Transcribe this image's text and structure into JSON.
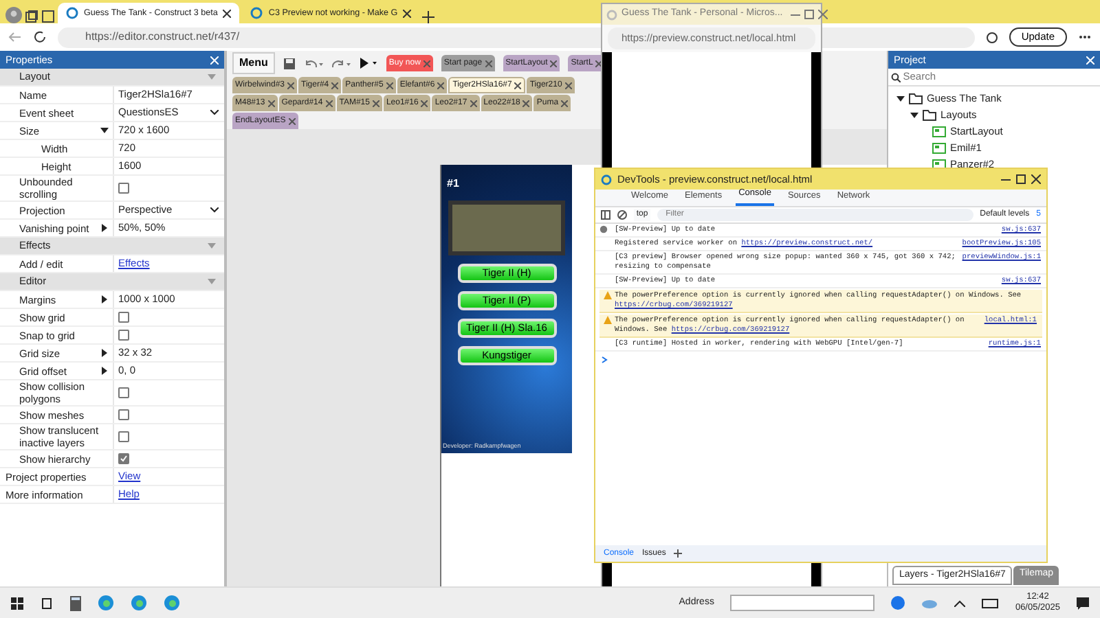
{
  "browser": {
    "tabs": [
      {
        "title": "Guess The Tank - Construct 3 beta",
        "selected": true
      },
      {
        "title": "C3 Preview not working - Make G",
        "selected": false
      }
    ],
    "url": "https://editor.construct.net/r437/",
    "update_button": "Update"
  },
  "properties": {
    "title": "Properties",
    "rows": [
      {
        "kind": "section",
        "label": "Layout"
      },
      {
        "kind": "text",
        "label": "Name",
        "value": "Tiger2HSla16#7"
      },
      {
        "kind": "select",
        "label": "Event sheet",
        "value": "QuestionsES"
      },
      {
        "kind": "text",
        "label": "Size",
        "value": "720 x 1600",
        "expanded": true,
        "children": [
          {
            "kind": "text",
            "label": "Width",
            "value": "720"
          },
          {
            "kind": "text",
            "label": "Height",
            "value": "1600"
          }
        ]
      },
      {
        "kind": "checkbox",
        "label": "Unbounded scrolling",
        "checked": false
      },
      {
        "kind": "select",
        "label": "Projection",
        "value": "Perspective"
      },
      {
        "kind": "text",
        "label": "Vanishing point",
        "value": "50%, 50%",
        "expanded": false
      },
      {
        "kind": "section",
        "label": "Effects"
      },
      {
        "kind": "link",
        "label": "Add / edit",
        "value": "Effects"
      },
      {
        "kind": "section",
        "label": "Editor"
      },
      {
        "kind": "text",
        "label": "Margins",
        "value": "1000 x 1000",
        "expanded": false
      },
      {
        "kind": "checkbox",
        "label": "Show grid",
        "checked": false
      },
      {
        "kind": "checkbox",
        "label": "Snap to grid",
        "checked": false
      },
      {
        "kind": "text",
        "label": "Grid size",
        "value": "32 x 32",
        "expanded": false
      },
      {
        "kind": "text",
        "label": "Grid offset",
        "value": "0, 0",
        "expanded": false
      },
      {
        "kind": "checkbox",
        "label": "Show collision polygons",
        "checked": false
      },
      {
        "kind": "checkbox",
        "label": "Show meshes",
        "checked": false
      },
      {
        "kind": "checkbox",
        "label": "Show translucent inactive layers",
        "checked": false
      },
      {
        "kind": "checkbox",
        "label": "Show hierarchy",
        "checked": true
      },
      {
        "kind": "footer-link",
        "label": "Project properties",
        "value": "View"
      },
      {
        "kind": "footer-link",
        "label": "More information",
        "value": "Help"
      }
    ]
  },
  "editor": {
    "menu_button": "Menu",
    "tab_rows": [
      [
        {
          "label": "Buy now",
          "color": "#f25656",
          "selected": false
        },
        {
          "label": "Start page",
          "color": "#9c9c9c",
          "selected": false
        },
        {
          "label": "StartLayout",
          "color": "#b9a4c4",
          "selected": false
        },
        {
          "label": "StartL",
          "color": "#b9a4c4",
          "selected": false
        }
      ],
      [
        {
          "label": "Wirbelwind#3",
          "color": "#bcb193",
          "selected": false
        },
        {
          "label": "Tiger#4",
          "color": "#bcb193",
          "selected": false
        },
        {
          "label": "Panther#5",
          "color": "#bcb193",
          "selected": false
        },
        {
          "label": "Elefant#6",
          "color": "#bcb193",
          "selected": false
        },
        {
          "label": "Tiger2HSla16#7",
          "color": "#bcb193",
          "selected": true
        },
        {
          "label": "Tiger210",
          "color": "#bcb193",
          "selected": false
        }
      ],
      [
        {
          "label": "M48#13",
          "color": "#bcb193",
          "selected": false
        },
        {
          "label": "Gepard#14",
          "color": "#bcb193",
          "selected": false
        },
        {
          "label": "TAM#15",
          "color": "#bcb193",
          "selected": false
        },
        {
          "label": "Leo1#16",
          "color": "#bcb193",
          "selected": false
        },
        {
          "label": "Leo2#17",
          "color": "#bcb193",
          "selected": false
        },
        {
          "label": "Leo22#18",
          "color": "#bcb193",
          "selected": false
        },
        {
          "label": "Puma",
          "color": "#bcb193",
          "selected": false
        }
      ],
      [
        {
          "label": "EndLayoutES",
          "color": "#b9a4c4",
          "selected": false
        }
      ]
    ],
    "game": {
      "number": "#1",
      "answers": [
        "Tiger II (H)",
        "Tiger II (P)",
        "Tiger II (H) Sla.16",
        "Kungstiger"
      ],
      "credit": "Developer: Radkampfwagen"
    }
  },
  "project": {
    "title": "Project",
    "search_placeholder": "Search",
    "tree": [
      {
        "label": "Guess The Tank",
        "expanded": true,
        "kind": "folder",
        "children": [
          {
            "label": "Layouts",
            "expanded": true,
            "kind": "folder",
            "children": [
              {
                "label": "StartLayout",
                "kind": "layout"
              },
              {
                "label": "Emil#1",
                "kind": "layout"
              },
              {
                "label": "Panzer#2",
                "kind": "layout"
              }
            ]
          }
        ]
      }
    ],
    "bottom_tabs": [
      {
        "label": "Layers - Tiger2HSla16#7",
        "selected": true
      },
      {
        "label": "Tilemap",
        "selected": false
      }
    ]
  },
  "preview_window": {
    "title": "Guess The Tank - Personal - Micros...",
    "url": "https://preview.construct.net/local.html"
  },
  "devtools": {
    "title": "DevTools - preview.construct.net/local.html",
    "tabs": [
      {
        "label": "Welcome",
        "selected": false
      },
      {
        "label": "Elements",
        "selected": false
      },
      {
        "label": "Console",
        "selected": true
      },
      {
        "label": "Sources",
        "selected": false
      },
      {
        "label": "Network",
        "selected": false
      }
    ],
    "context": "top",
    "filter_placeholder": "Filter",
    "levels": "Default levels",
    "issue_count": "5",
    "messages": [
      {
        "kind": "info",
        "text": "[SW-Preview] Up to date",
        "source": "sw.js:637"
      },
      {
        "kind": "log",
        "text": "Registered service worker on ",
        "link": "https://preview.construct.net/",
        "source": "bootPreview.js:105"
      },
      {
        "kind": "log",
        "text": "[C3 preview] Browser opened wrong size popup: wanted 360 x 745, got 360 x 742; resizing to compensate",
        "source": "previewWindow.js:1"
      },
      {
        "kind": "log",
        "text": "[SW-Preview] Up to date",
        "source": "sw.js:637"
      },
      {
        "kind": "warning",
        "text": "The powerPreference option is currently ignored when calling requestAdapter() on Windows. See ",
        "link": "https://crbug.com/369219127"
      },
      {
        "kind": "warning",
        "text": "The powerPreference option is currently ignored when calling requestAdapter() on Windows. See ",
        "link": "https://crbug.com/369219127",
        "source": "local.html:1"
      },
      {
        "kind": "log",
        "text": "[C3 runtime] Hosted in worker, rendering with WebGPU [Intel/gen-7]",
        "source": "runtime.js:1"
      }
    ],
    "drawer_tabs": [
      {
        "label": "Console",
        "selected": true
      },
      {
        "label": "Issues",
        "selected": false
      }
    ]
  },
  "taskbar": {
    "address_label": "Address",
    "time": "12:42",
    "date": "06/05/2025"
  }
}
